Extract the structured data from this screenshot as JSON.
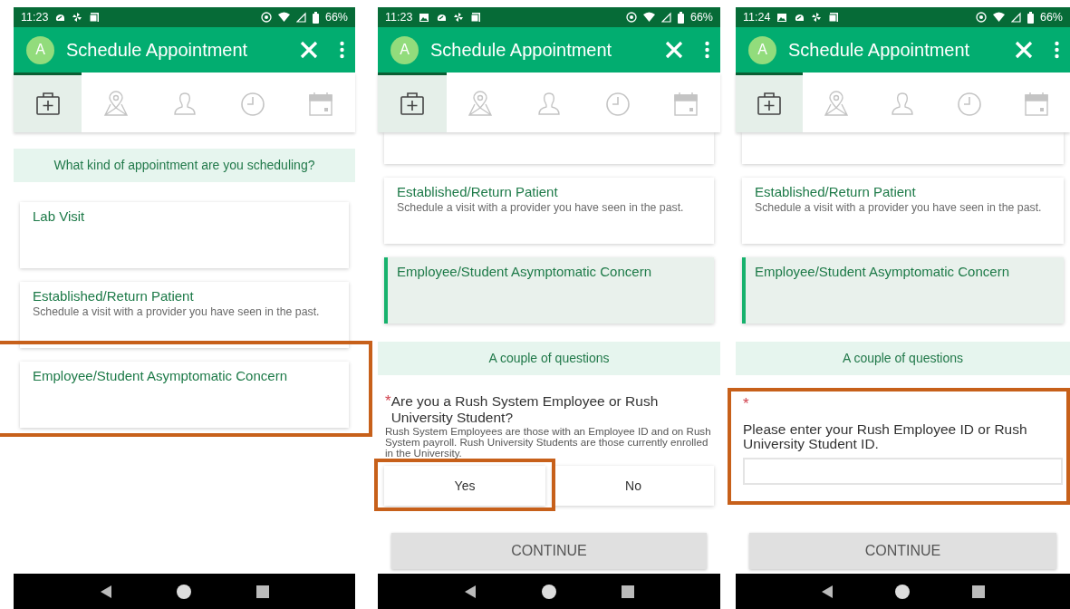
{
  "screens": [
    {
      "status": {
        "time": "11:23",
        "image_notification": false,
        "battery": "66%"
      },
      "app_bar": {
        "avatar": "A",
        "title": "Schedule Appointment"
      },
      "tabs": [
        {
          "kind": "kit",
          "selected": true
        },
        {
          "kind": "map",
          "selected": false
        },
        {
          "kind": "person",
          "selected": false
        },
        {
          "kind": "clock",
          "selected": false
        },
        {
          "kind": "calendar",
          "selected": false
        }
      ],
      "content": [
        {
          "kind": "prompt",
          "text": "What kind of appointment are you scheduling?"
        },
        {
          "kind": "card",
          "title": "Lab Visit",
          "selected": false,
          "highlighted": false
        },
        {
          "kind": "card",
          "title": "Established/Return Patient",
          "subtitle": "Schedule a visit with a provider you have seen in the past.",
          "selected": false,
          "highlighted": false
        },
        {
          "kind": "card",
          "title": "Employee/Student Asymptomatic Concern",
          "selected": false,
          "highlighted": true
        }
      ]
    },
    {
      "status": {
        "time": "11:23",
        "image_notification": true,
        "battery": "66%"
      },
      "app_bar": {
        "avatar": "A",
        "title": "Schedule Appointment"
      },
      "tabs": [
        {
          "kind": "kit",
          "selected": true
        },
        {
          "kind": "map",
          "selected": false
        },
        {
          "kind": "person",
          "selected": false
        },
        {
          "kind": "clock",
          "selected": false
        },
        {
          "kind": "calendar",
          "selected": false
        }
      ],
      "content": [
        {
          "kind": "card_edge"
        },
        {
          "kind": "card",
          "title": "Established/Return Patient",
          "subtitle": "Schedule a visit with a provider you have seen in the past.",
          "selected": false,
          "highlighted": false
        },
        {
          "kind": "card",
          "title": "Employee/Student Asymptomatic Concern",
          "selected": true,
          "highlighted": false
        },
        {
          "kind": "prompt",
          "text": "A couple of questions"
        },
        {
          "kind": "question",
          "required_mark": "*",
          "text": "Are you a Rush System Employee or Rush University Student?",
          "help": "Rush System Employees are those with an Employee ID and on Rush System payroll. Rush University Students are those currently enrolled in the University."
        },
        {
          "kind": "choices",
          "options": [
            {
              "label": "Yes",
              "highlighted": true
            },
            {
              "label": "No",
              "highlighted": false
            }
          ]
        },
        {
          "kind": "button",
          "label": "CONTINUE"
        }
      ]
    },
    {
      "status": {
        "time": "11:24",
        "image_notification": true,
        "battery": "66%"
      },
      "app_bar": {
        "avatar": "A",
        "title": "Schedule Appointment"
      },
      "tabs": [
        {
          "kind": "kit",
          "selected": true
        },
        {
          "kind": "map",
          "selected": false
        },
        {
          "kind": "person",
          "selected": false
        },
        {
          "kind": "clock",
          "selected": false
        },
        {
          "kind": "calendar",
          "selected": false
        }
      ],
      "content": [
        {
          "kind": "card_edge"
        },
        {
          "kind": "card",
          "title": "Established/Return Patient",
          "subtitle": "Schedule a visit with a provider you have seen in the past.",
          "selected": false,
          "highlighted": false
        },
        {
          "kind": "card",
          "title": "Employee/Student Asymptomatic Concern",
          "selected": true,
          "highlighted": false
        },
        {
          "kind": "prompt",
          "text": "A couple of questions"
        },
        {
          "kind": "text_field",
          "required_mark": "*",
          "label": "Please enter your Rush Employee ID or Rush University Student ID.",
          "highlighted": true
        },
        {
          "kind": "button",
          "label": "CONTINUE"
        }
      ]
    }
  ]
}
